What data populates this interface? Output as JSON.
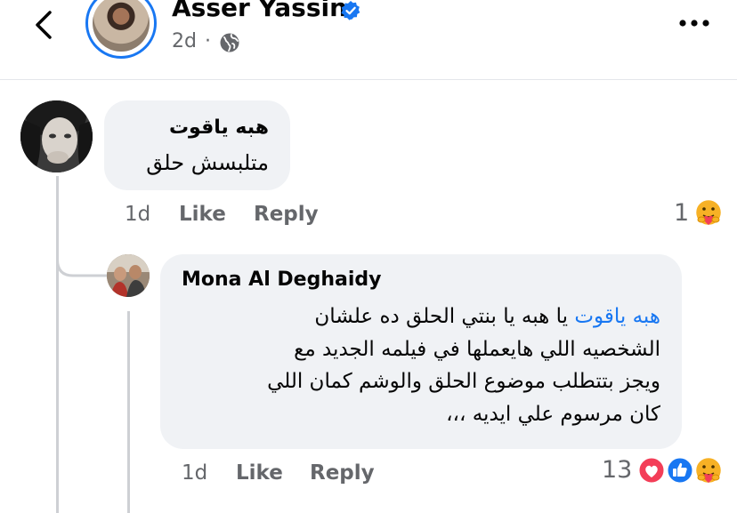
{
  "header": {
    "author_name": "Asser Yassin",
    "post_time": "2d",
    "separator": "·",
    "icons": {
      "back": "chevron-left-icon",
      "verified": "verified-badge-icon",
      "audience": "globe-icon",
      "more": "more-dots-icon"
    }
  },
  "comments": [
    {
      "author": "هبه ياقوت",
      "text": "متلبسش حلق",
      "time": "1d",
      "like_label": "Like",
      "reply_label": "Reply",
      "reaction_count": "1",
      "reactions": [
        "care"
      ]
    }
  ],
  "replies": [
    {
      "author": "Mona Al Deghaidy",
      "mention": "هبه ياقوت",
      "lines": [
        " يا هبه يا بنتي الحلق ده علشان",
        "الشخصيه اللي هايعملها في فيلمه الجديد مع",
        "ويجز بتتطلب موضوع الحلق والوشم كمان اللي",
        "كان مرسوم علي ايديه ،،،"
      ],
      "time": "1d",
      "like_label": "Like",
      "reply_label": "Reply",
      "reaction_count": "13",
      "reactions": [
        "love",
        "like",
        "care"
      ]
    }
  ],
  "colors": {
    "accent": "#1877f2",
    "bubble": "#f0f2f5",
    "meta": "#65676b",
    "love": "#f33e58",
    "care": "#f7b125"
  }
}
